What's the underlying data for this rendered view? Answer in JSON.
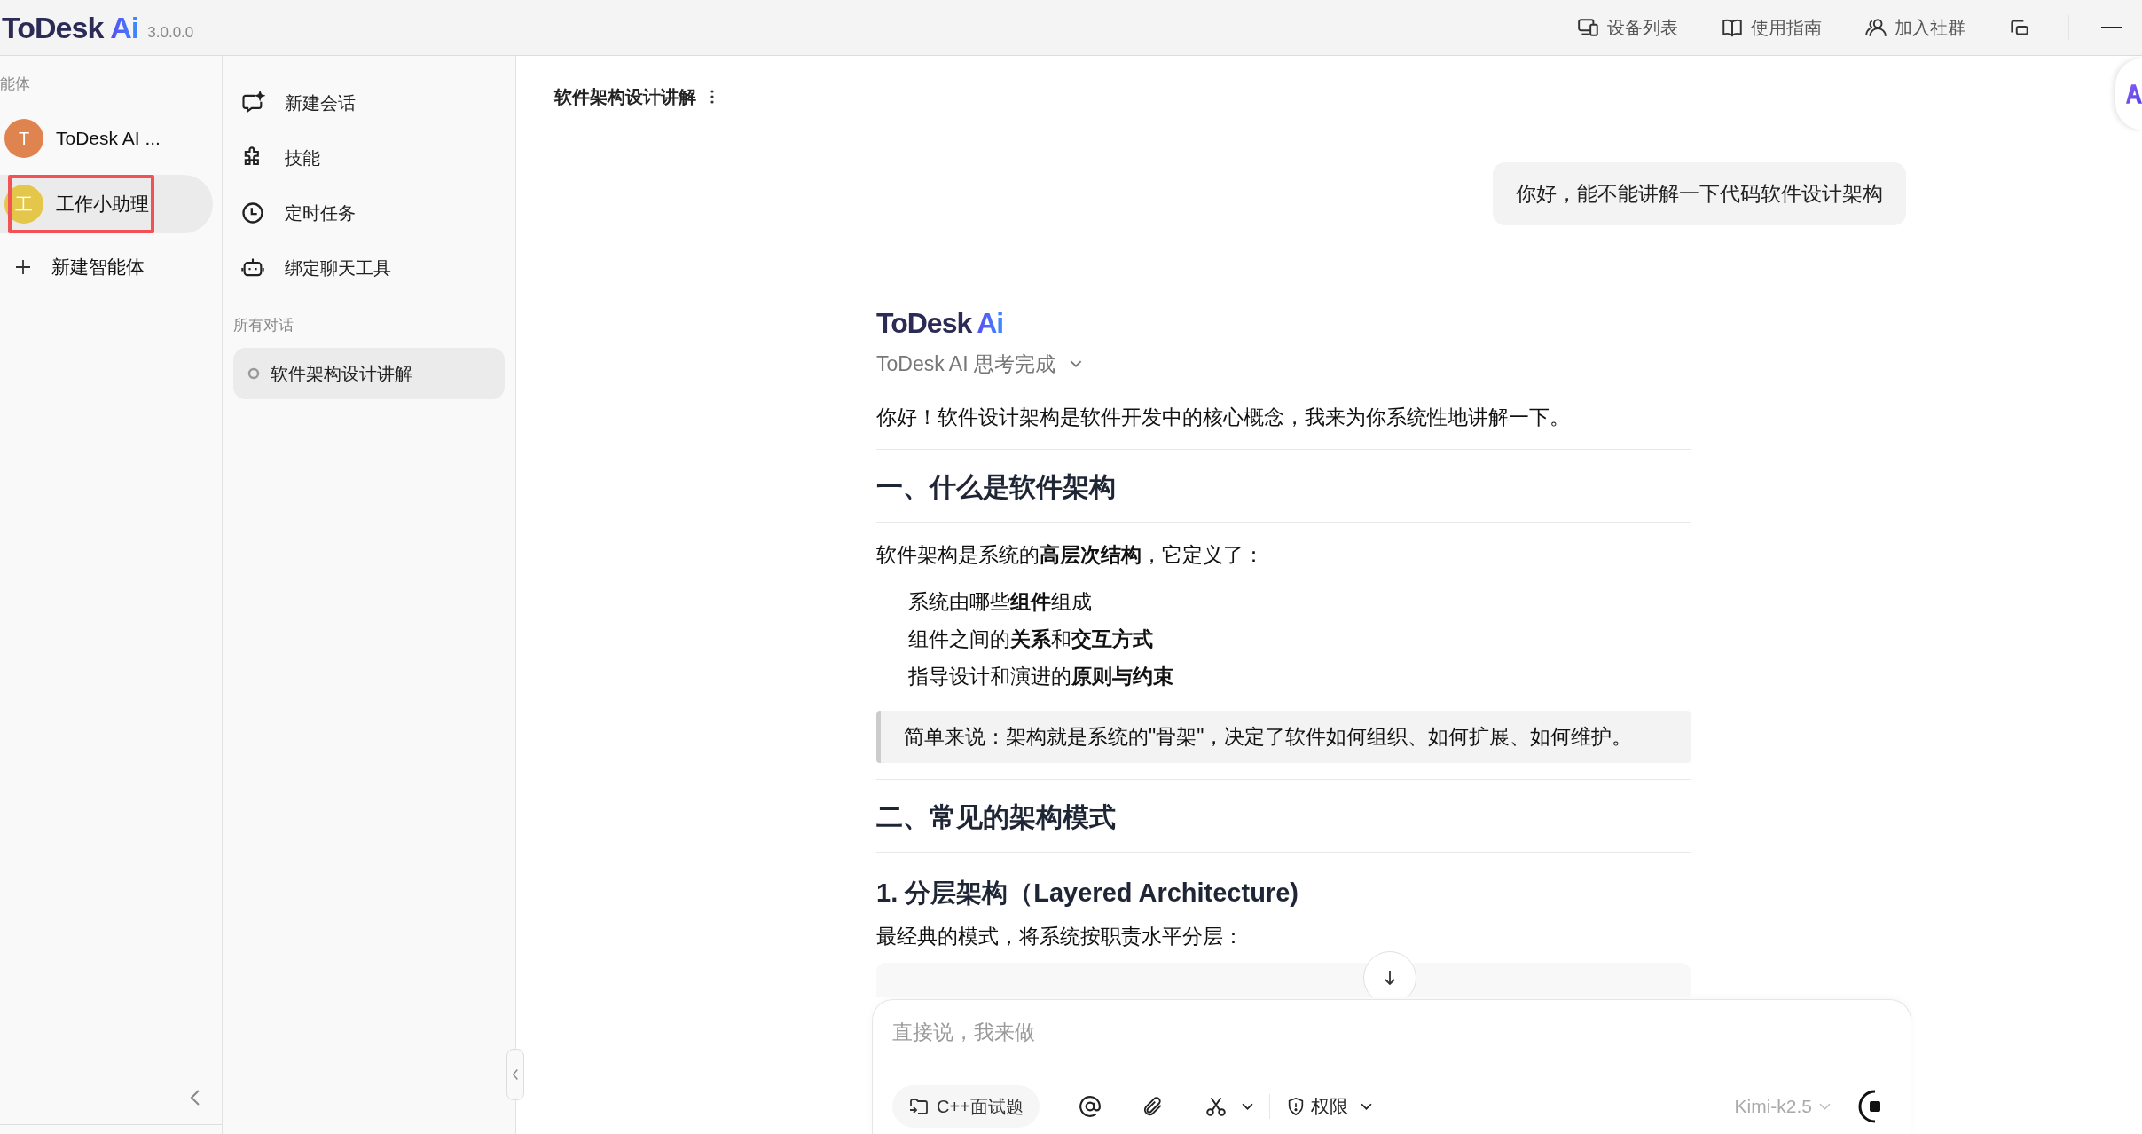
{
  "app": {
    "logo": {
      "name": "ToDesk",
      "accent": "Ai"
    },
    "version": "3.0.0.0"
  },
  "top_bar": {
    "items": [
      {
        "label": "设备列表",
        "kind": "devices"
      },
      {
        "label": "使用指南",
        "kind": "guide"
      },
      {
        "label": "加入社群",
        "kind": "community"
      }
    ]
  },
  "agents": {
    "heading": "能体",
    "items": [
      {
        "avatar": "T",
        "name": "ToDesk AI ...",
        "color": "#e0844f",
        "selected": false,
        "highlighted": false
      },
      {
        "avatar": "工",
        "name": "工作小助理",
        "color": "#e4c74a",
        "selected": true,
        "highlighted": true
      }
    ],
    "new_agent": "新建智能体"
  },
  "nav": {
    "items": [
      {
        "label": "新建会话",
        "kind": "new-chat"
      },
      {
        "label": "技能",
        "kind": "skills"
      },
      {
        "label": "定时任务",
        "kind": "schedule"
      },
      {
        "label": "绑定聊天工具",
        "kind": "bot"
      }
    ],
    "section": "所有对话",
    "conversations": [
      {
        "title": "软件架构设计讲解",
        "selected": true
      }
    ]
  },
  "chat": {
    "title": "软件架构设计讲解",
    "user_message": "你好，能不能讲解一下代码软件设计架构",
    "reply": {
      "logo": {
        "name": "ToDesk",
        "accent": "Ai"
      },
      "status": "ToDesk AI 思考完成",
      "blocks": [
        {
          "kind": "p",
          "text": "你好！软件设计架构是软件开发中的核心概念，我来为你系统性地讲解一下。"
        },
        {
          "kind": "rule"
        },
        {
          "kind": "h2",
          "text": "一、什么是软件架构"
        },
        {
          "kind": "rule"
        },
        {
          "kind": "p",
          "text": "软件架构是系统的**高层次结构**，它定义了："
        },
        {
          "kind": "list",
          "items": [
            "系统由哪些**组件**组成",
            "组件之间的**关系**和**交互方式**",
            "指导设计和演进的**原则与约束**"
          ]
        },
        {
          "kind": "quote",
          "text": "简单来说：架构就是系统的\"骨架\"，决定了软件如何组织、如何扩展、如何维护。"
        },
        {
          "kind": "rule"
        },
        {
          "kind": "h2",
          "text": "二、常见的架构模式"
        },
        {
          "kind": "rule"
        },
        {
          "kind": "h3",
          "text": "1. 分层架构（Layered Architecture)"
        },
        {
          "kind": "p",
          "text": "最经典的模式，将系统按职责水平分层："
        },
        {
          "kind": "code"
        }
      ]
    }
  },
  "input": {
    "placeholder": "直接说，我来做",
    "chip": "C++面试题",
    "permission": "权限",
    "model": "Kimi-k2.5"
  }
}
